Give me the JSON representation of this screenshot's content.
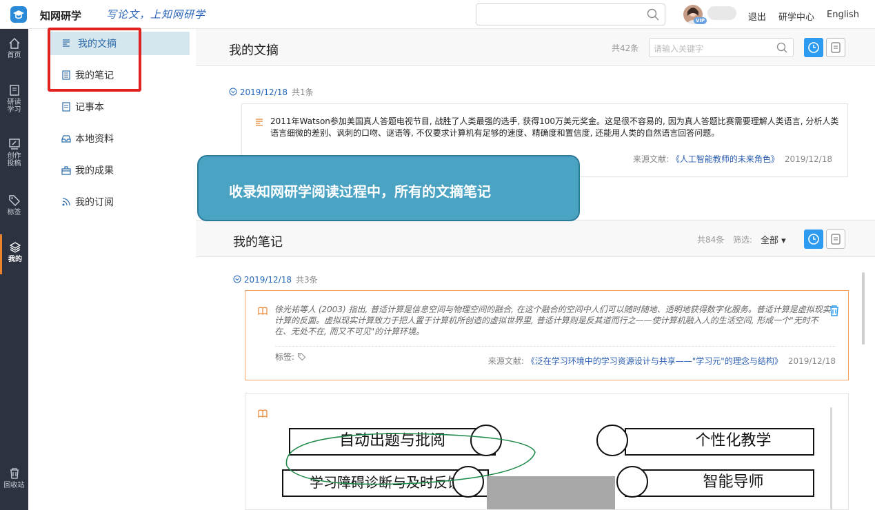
{
  "brand": {
    "name": "知网研学",
    "slogan": "写论文，上知网研学"
  },
  "header": {
    "search_placeholder": "",
    "links": [
      "退出",
      "研学中心",
      "English"
    ],
    "vip": "VIP"
  },
  "sidebar": {
    "items": [
      {
        "label": "首页",
        "icon": "home-icon"
      },
      {
        "label": "研读学习",
        "icon": "book-icon"
      },
      {
        "label": "创作投稿",
        "icon": "edit-icon"
      },
      {
        "label": "标签",
        "icon": "tag-icon"
      },
      {
        "label": "我的",
        "icon": "layers-icon",
        "active": true
      },
      {
        "label": "回收站",
        "icon": "trash-icon"
      }
    ]
  },
  "submenu": {
    "items": [
      {
        "label": "我的文摘",
        "selected": true
      },
      {
        "label": "我的笔记"
      },
      {
        "label": "记事本"
      },
      {
        "label": "本地资料"
      },
      {
        "label": "我的成果"
      },
      {
        "label": "我的订阅"
      }
    ]
  },
  "digest": {
    "title": "我的文摘",
    "count": "共42条",
    "search_placeholder": "请输入关键字",
    "group_date": "2019/12/18",
    "group_count": "共1条",
    "text": "2011年Watson参加美国真人答题电视节目, 战胜了人类最强的选手, 获得100万美元奖金。这是很不容易的, 因为真人答题比赛需要理解人类语言, 分析人类语言细微的差别、讽刺的口吻、谜语等, 不仅要求计算机有足够的速度、精确度和置信度, 还能用人类的自然语言回答问题。",
    "source_label": "来源文献:",
    "source": "《人工智能教师的未来角色》",
    "source_date": "2019/12/18"
  },
  "callout": "收录知网研学阅读过程中，所有的文摘笔记",
  "notes": {
    "title": "我的笔记",
    "count": "共84条",
    "filter_label": "筛选:",
    "filter_value": "全部",
    "group_date": "2019/12/18",
    "group_count": "共3条",
    "text": "徐光祐等人 (2003) 指出, 普适计算是信息空间与物理空间的融合, 在这个融合的空间中人们可以随时随地、透明地获得数字化服务。普适计算是虚拟现实计算的反面。虚拟现实计算致力于把人置于计算机所创造的虚拟世界里, 普适计算则是反其道而行之——使计算机融入人的生活空间, 形成一个\"无时不在、无处不在, 而又不可见\"的计算环境。",
    "tag_label": "标签:",
    "source_label": "来源文献:",
    "source": "《泛在学习环境中的学习资源设计与共享——\"学习元\"的理念与结构》",
    "source_date": "2019/12/18",
    "image_labels": [
      "自动出题与批阅",
      "个性化教学",
      "学习障碍诊断与及时反馈",
      "智能导师"
    ]
  }
}
